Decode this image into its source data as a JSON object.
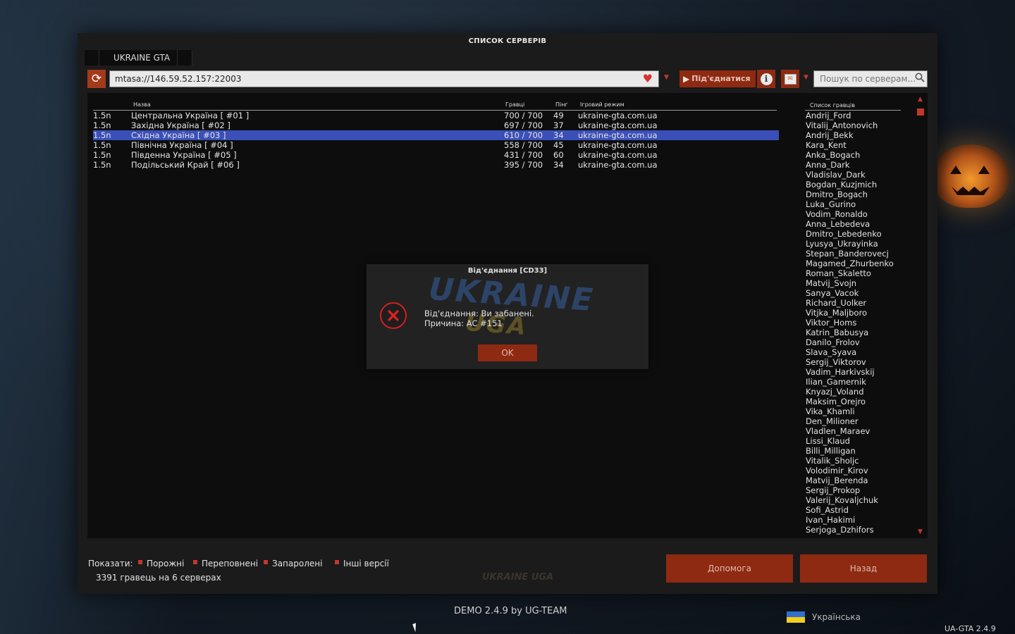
{
  "window": {
    "title": "СПИСОК СЕРВЕРІВ"
  },
  "tabs": [
    {
      "label": "UKRAINE GTA"
    }
  ],
  "toolbar": {
    "address_value": "mtasa://146.59.52.157:22003",
    "connect_label": "Під'єднатися",
    "search_placeholder": "Пошук по серверам...",
    "icons": [
      "refresh-icon",
      "heart-icon",
      "info-icon",
      "host-game-icon",
      "search-icon"
    ]
  },
  "table": {
    "headers": {
      "name": "Назва",
      "players": "Гравці",
      "ping": "Пінг",
      "gamemode": "Ігровий режим"
    },
    "rows": [
      {
        "version": "1.5n",
        "name": "Центральна Україна [ #01 ]",
        "players": "700 / 700",
        "ping": "49",
        "gamemode": "ukraine-gta.com.ua"
      },
      {
        "version": "1.5n",
        "name": "Західна Україна [ #02 ]",
        "players": "697 / 700",
        "ping": "37",
        "gamemode": "ukraine-gta.com.ua"
      },
      {
        "version": "1.5n",
        "name": "Східна Україна [ #03 ]",
        "players": "610 / 700",
        "ping": "34",
        "gamemode": "ukraine-gta.com.ua"
      },
      {
        "version": "1.5n",
        "name": "Північна Україна [ #04 ]",
        "players": "558 / 700",
        "ping": "45",
        "gamemode": "ukraine-gta.com.ua"
      },
      {
        "version": "1.5n",
        "name": "Південна Україна [ #05 ]",
        "players": "431 / 700",
        "ping": "60",
        "gamemode": "ukraine-gta.com.ua"
      },
      {
        "version": "1.5n",
        "name": "Подільський Край [ #06 ]",
        "players": "395 / 700",
        "ping": "34",
        "gamemode": "ukraine-gta.com.ua"
      }
    ],
    "selected_index": 2
  },
  "players": {
    "header": "Список гравців",
    "list": [
      "Andrij_Ford",
      "Vitalij_Antonovich",
      "Andrij_Bekk",
      "Kara_Kent",
      "Anka_Bogach",
      "Anna_Dark",
      "Vladislav_Dark",
      "Bogdan_Kuzjmich",
      "Dmitro_Bogach",
      "Luka_Gurino",
      "Vodim_Ronaldo",
      "Anna_Lebedeva",
      "Dmitro_Lebedenko",
      "Lyusya_Ukrayinka",
      "Stepan_Banderovecj",
      "Magamed_Zhurbenko",
      "Roman_Skaletto",
      "Matvij_Svojn",
      "Sanya_Vacok",
      "Richard_Uolker",
      "Vitjka_Maljboro",
      "Viktor_Homs",
      "Katrin_Babusya",
      "Danilo_Frolov",
      "Slava_Syava",
      "Sergij_Viktorov",
      "Vadim_Harkivskij",
      "Ilian_Gamernik",
      "Knyazj_Voland",
      "Maksim_Orejro",
      "Vika_Khamli",
      "Den_Milioner",
      "Vladlen_Maraev",
      "Lissi_Klaud",
      "Billi_Milligan",
      "Vitalik_Sholjc",
      "Volodimir_Kirov",
      "Matvij_Berenda",
      "Sergij_Prokop",
      "Valerij_Kovaljchuk",
      "Sofi_Astrid",
      "Ivan_Hakimi",
      "Serjoga_Dzhifors"
    ]
  },
  "dialog": {
    "title": "Від'єднання [CD33]",
    "line1": "Від'єднання: Ви забанені.",
    "line2": "Причина: AC #151",
    "ok_label": "OK",
    "logo_line1": "UKRAINE",
    "logo_line2": "UGA"
  },
  "filters": {
    "label": "Показати:",
    "items": [
      "Порожні",
      "Переповнені",
      "Запаролені",
      "Інші версії"
    ]
  },
  "status": {
    "count_text": "3391 гравець на 6 серверах"
  },
  "buttons": {
    "help": "Допомога",
    "back": "Назад"
  },
  "footer": {
    "demo": "DEMO 2.4.9 by UG-TEAM",
    "language": "Українська",
    "version": "UA-GTA 2.4.9",
    "logo": "UKRAINE UGA"
  },
  "colors": {
    "accent": "#8e2a12",
    "selection": "#3a4fb8",
    "filter_box": "#c0392b"
  }
}
